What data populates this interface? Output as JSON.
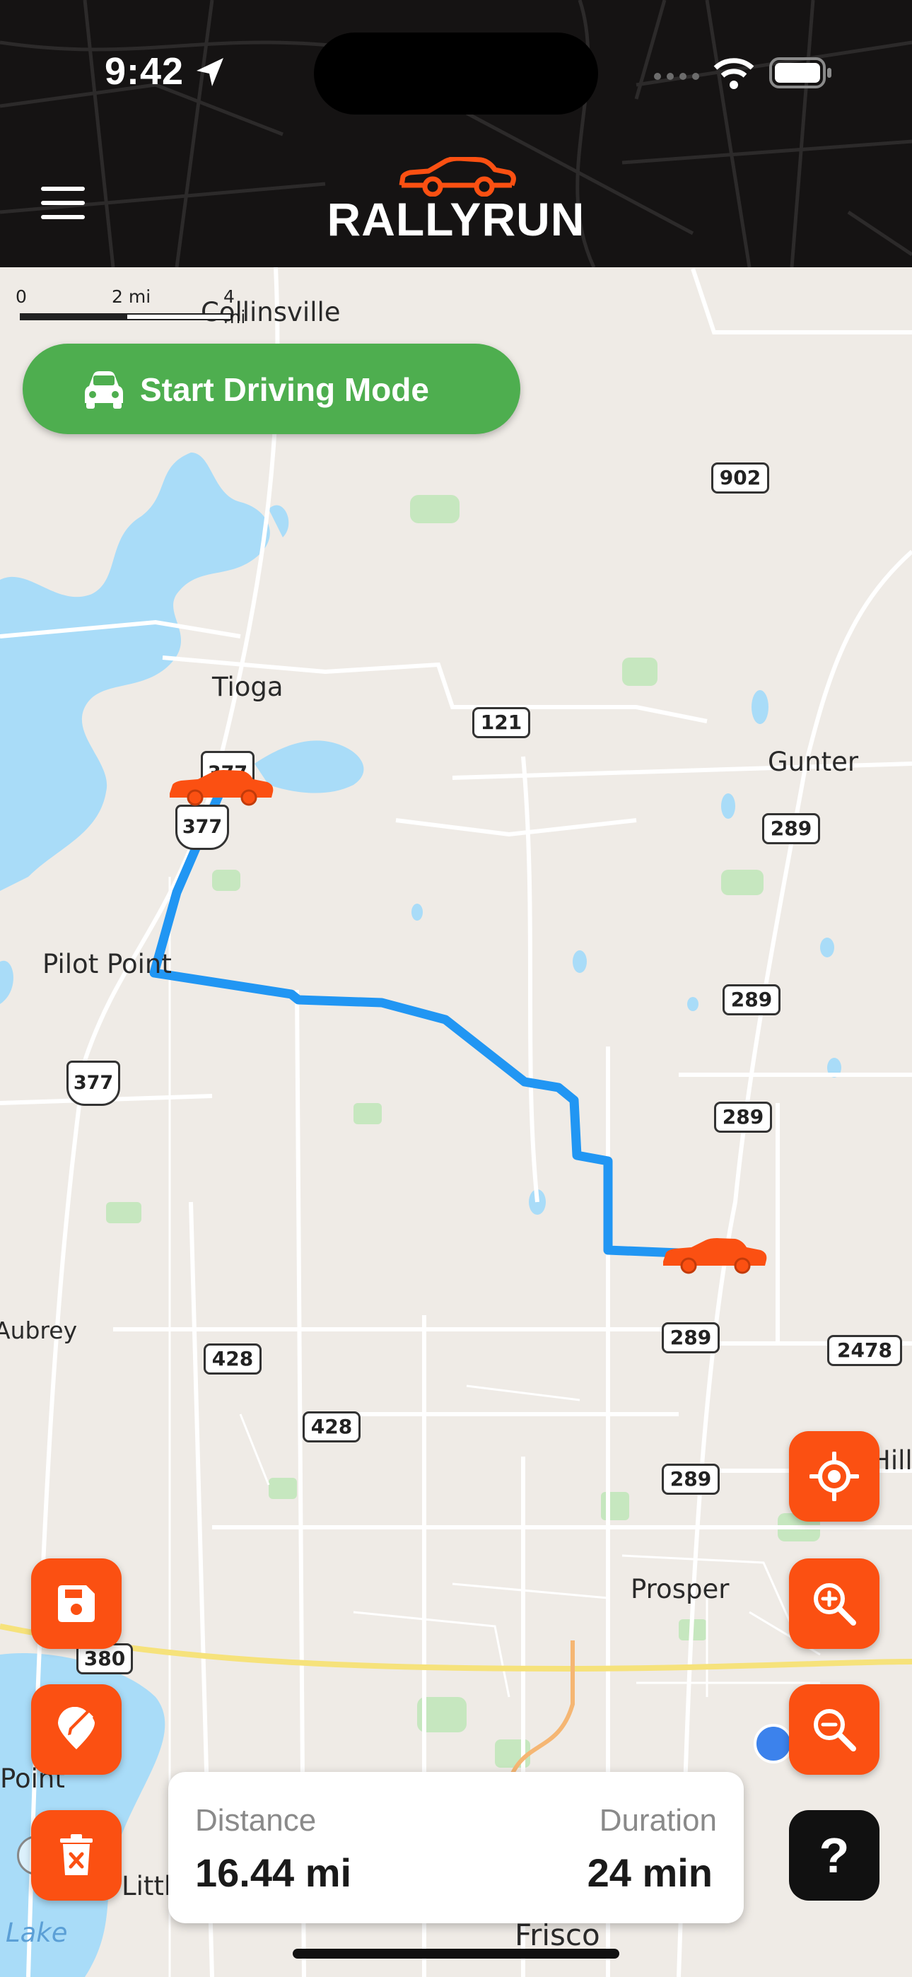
{
  "status_bar": {
    "time": "9:42"
  },
  "header": {
    "logo_text": "RALLYRUN",
    "menu_icon": "hamburger-menu-icon"
  },
  "scale_bar": {
    "ticks": [
      "0",
      "2 mi",
      "4 mi"
    ]
  },
  "drive_button": {
    "label": "Start Driving Mode",
    "icon": "car-icon"
  },
  "map": {
    "places": [
      "Collinsville",
      "Tioga",
      "Gunter",
      "Pilot Point",
      "Aubrey",
      "Prosper",
      "Frisco",
      "Point",
      "Lake",
      "Little",
      "Hills"
    ],
    "highway_shields": [
      "902",
      "121",
      "289",
      "289",
      "289",
      "289",
      "289",
      "2478",
      "428",
      "428",
      "380"
    ],
    "us_routes": [
      "377",
      "377",
      "377"
    ],
    "route_color": "#2196f3",
    "marker_color": "#fb5012"
  },
  "actions": {
    "save": "save-icon",
    "edit_waypoint": "edit-pin-icon",
    "delete": "trash-icon",
    "locate": "locate-icon",
    "zoom_in": "zoom-in-icon",
    "zoom_out": "zoom-out-icon",
    "help_label": "?"
  },
  "trip": {
    "distance_label": "Distance",
    "distance_value": "16.44 mi",
    "duration_label": "Duration",
    "duration_value": "24 min"
  },
  "colors": {
    "accent": "#fb5012",
    "drive_green": "#4eae4f",
    "header_bg": "#151313"
  }
}
